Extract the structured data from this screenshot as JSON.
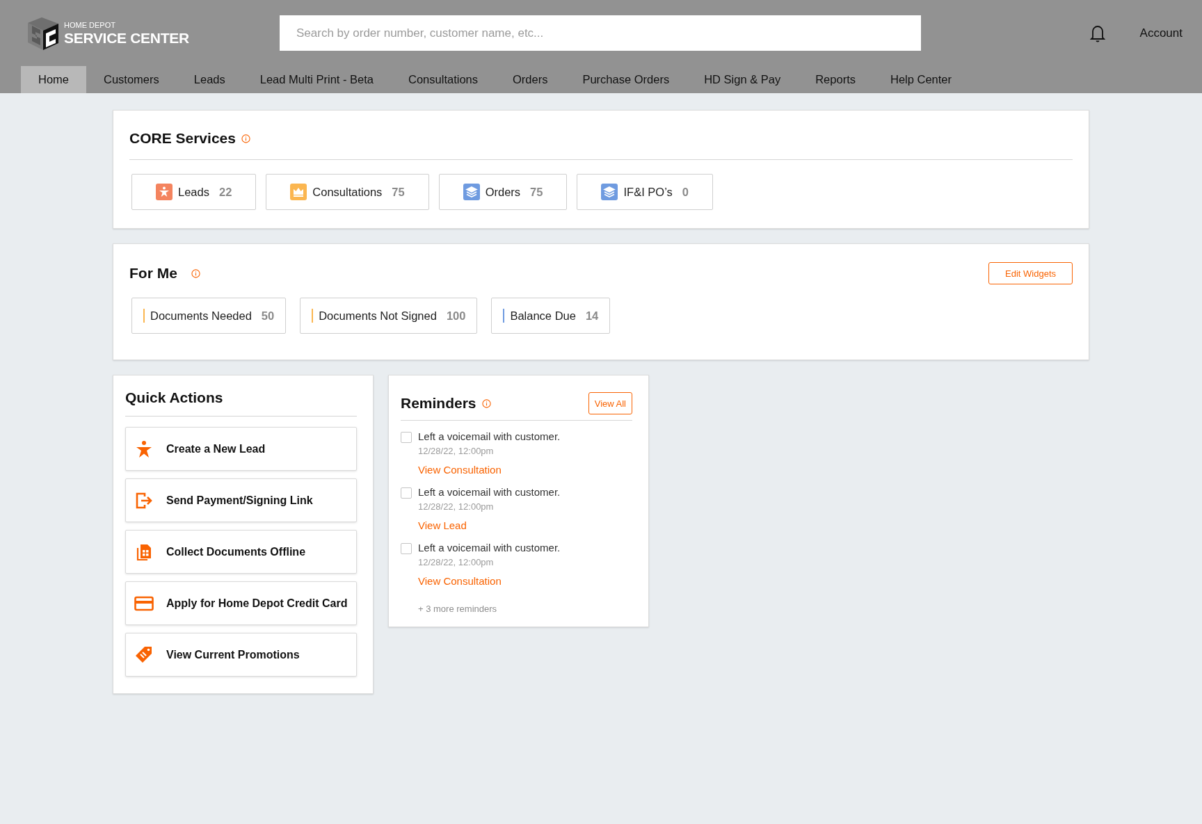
{
  "header": {
    "logo": {
      "top_line": "HOME DEPOT",
      "main_line": "SERVICE CENTER"
    },
    "search": {
      "placeholder": "Search by order number, customer name, etc..."
    },
    "account": "Account"
  },
  "nav": [
    {
      "label": "Home",
      "selected": true
    },
    {
      "label": "Customers",
      "selected": false
    },
    {
      "label": "Leads",
      "selected": false
    },
    {
      "label": "Lead Multi Print - Beta",
      "selected": false
    },
    {
      "label": "Consultations",
      "selected": false
    },
    {
      "label": "Orders",
      "selected": false
    },
    {
      "label": "Purchase Orders",
      "selected": false
    },
    {
      "label": "HD Sign & Pay",
      "selected": false
    },
    {
      "label": "Reports",
      "selected": false
    },
    {
      "label": "Help Center",
      "selected": false
    }
  ],
  "core_services": {
    "title": "CORE Services",
    "tiles": [
      {
        "kind": "person",
        "label": "Leads",
        "count": "22",
        "color": "#f4845f"
      },
      {
        "kind": "crown",
        "label": "Consultations",
        "count": "75",
        "color": "#fbb650"
      },
      {
        "kind": "stack",
        "label": "Orders",
        "count": "75",
        "color": "#6f9be0"
      },
      {
        "kind": "stack",
        "label": "IF&I PO’s",
        "count": "0",
        "color": "#6f9be0"
      }
    ]
  },
  "for_me": {
    "title": "For Me",
    "edit_button": "Edit Widgets",
    "tiles": [
      {
        "label": "Documents Needed",
        "count": "50",
        "color": "#fbb650"
      },
      {
        "label": "Documents Not Signed",
        "count": "100",
        "color": "#fbb650"
      },
      {
        "label": "Balance Due",
        "count": "14",
        "color": "#6f9be0"
      }
    ]
  },
  "quick_actions": {
    "title": "Quick Actions",
    "items": [
      {
        "kind": "person",
        "label": "Create a New Lead"
      },
      {
        "kind": "send",
        "label": "Send Payment/Signing Link"
      },
      {
        "kind": "documents",
        "label": "Collect Documents Offline"
      },
      {
        "kind": "card",
        "label": "Apply for Home Depot Credit Card"
      },
      {
        "kind": "tag",
        "label": "View Current Promotions"
      }
    ]
  },
  "reminders": {
    "title": "Reminders",
    "view_all": "View All",
    "items": [
      {
        "text": "Left a voicemail with customer.",
        "time": "12/28/22, 12:00pm",
        "link": "View Consultation",
        "checked": false
      },
      {
        "text": "Left a voicemail with customer.",
        "time": "12/28/22, 12:00pm",
        "link": "View Lead",
        "checked": false
      },
      {
        "text": "Left a voicemail with customer.",
        "time": "12/28/22, 12:00pm",
        "link": "View Consultation",
        "checked": false
      }
    ],
    "more": "+ 3 more reminders"
  }
}
